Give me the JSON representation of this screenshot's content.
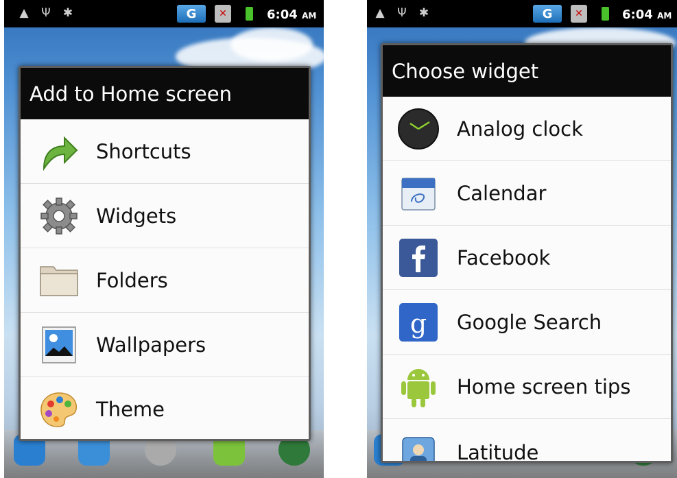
{
  "status_bar": {
    "time": "6:04",
    "ampm": "AM",
    "network": "G"
  },
  "left_dialog": {
    "title": "Add to Home screen",
    "items": [
      {
        "label": "Shortcuts",
        "icon": "shortcut-arrow-icon"
      },
      {
        "label": "Widgets",
        "icon": "gear-icon"
      },
      {
        "label": "Folders",
        "icon": "folder-icon"
      },
      {
        "label": "Wallpapers",
        "icon": "wallpaper-icon"
      },
      {
        "label": "Theme",
        "icon": "palette-icon"
      }
    ]
  },
  "right_dialog": {
    "title": "Choose widget",
    "items": [
      {
        "label": "Analog clock",
        "icon": "clock-icon"
      },
      {
        "label": "Calendar",
        "icon": "calendar-icon"
      },
      {
        "label": "Facebook",
        "icon": "facebook-icon"
      },
      {
        "label": "Google Search",
        "icon": "google-search-icon"
      },
      {
        "label": "Home screen tips",
        "icon": "android-icon"
      },
      {
        "label": "Latitude",
        "icon": "latitude-icon"
      }
    ]
  },
  "colors": {
    "title_bar": "#0b0b0b",
    "list_bg": "#fbfbfb",
    "divider": "#dedede",
    "status_bar": "#000000"
  }
}
